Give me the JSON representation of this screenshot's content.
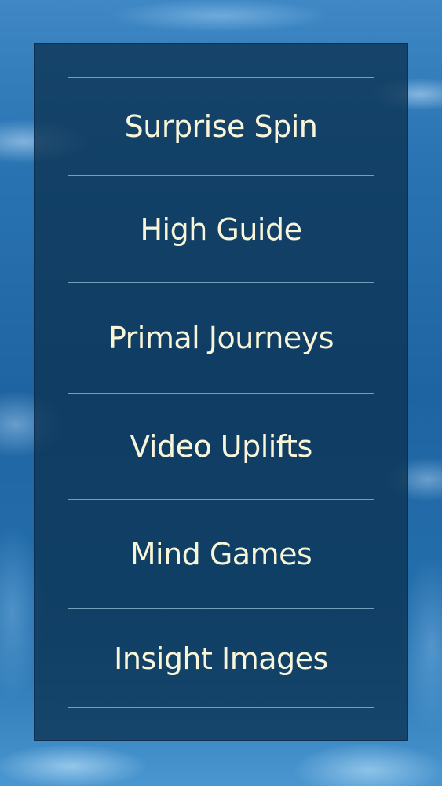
{
  "menu": {
    "items": [
      {
        "label": "Surprise Spin"
      },
      {
        "label": "High Guide"
      },
      {
        "label": "Primal Journeys"
      },
      {
        "label": "Video Uplifts"
      },
      {
        "label": "Mind Games"
      },
      {
        "label": "Insight Images"
      }
    ]
  },
  "colors": {
    "background": "#2a74b3",
    "panel": "#0c3252",
    "text": "#f8f5d8",
    "divider": "#96bed7"
  }
}
